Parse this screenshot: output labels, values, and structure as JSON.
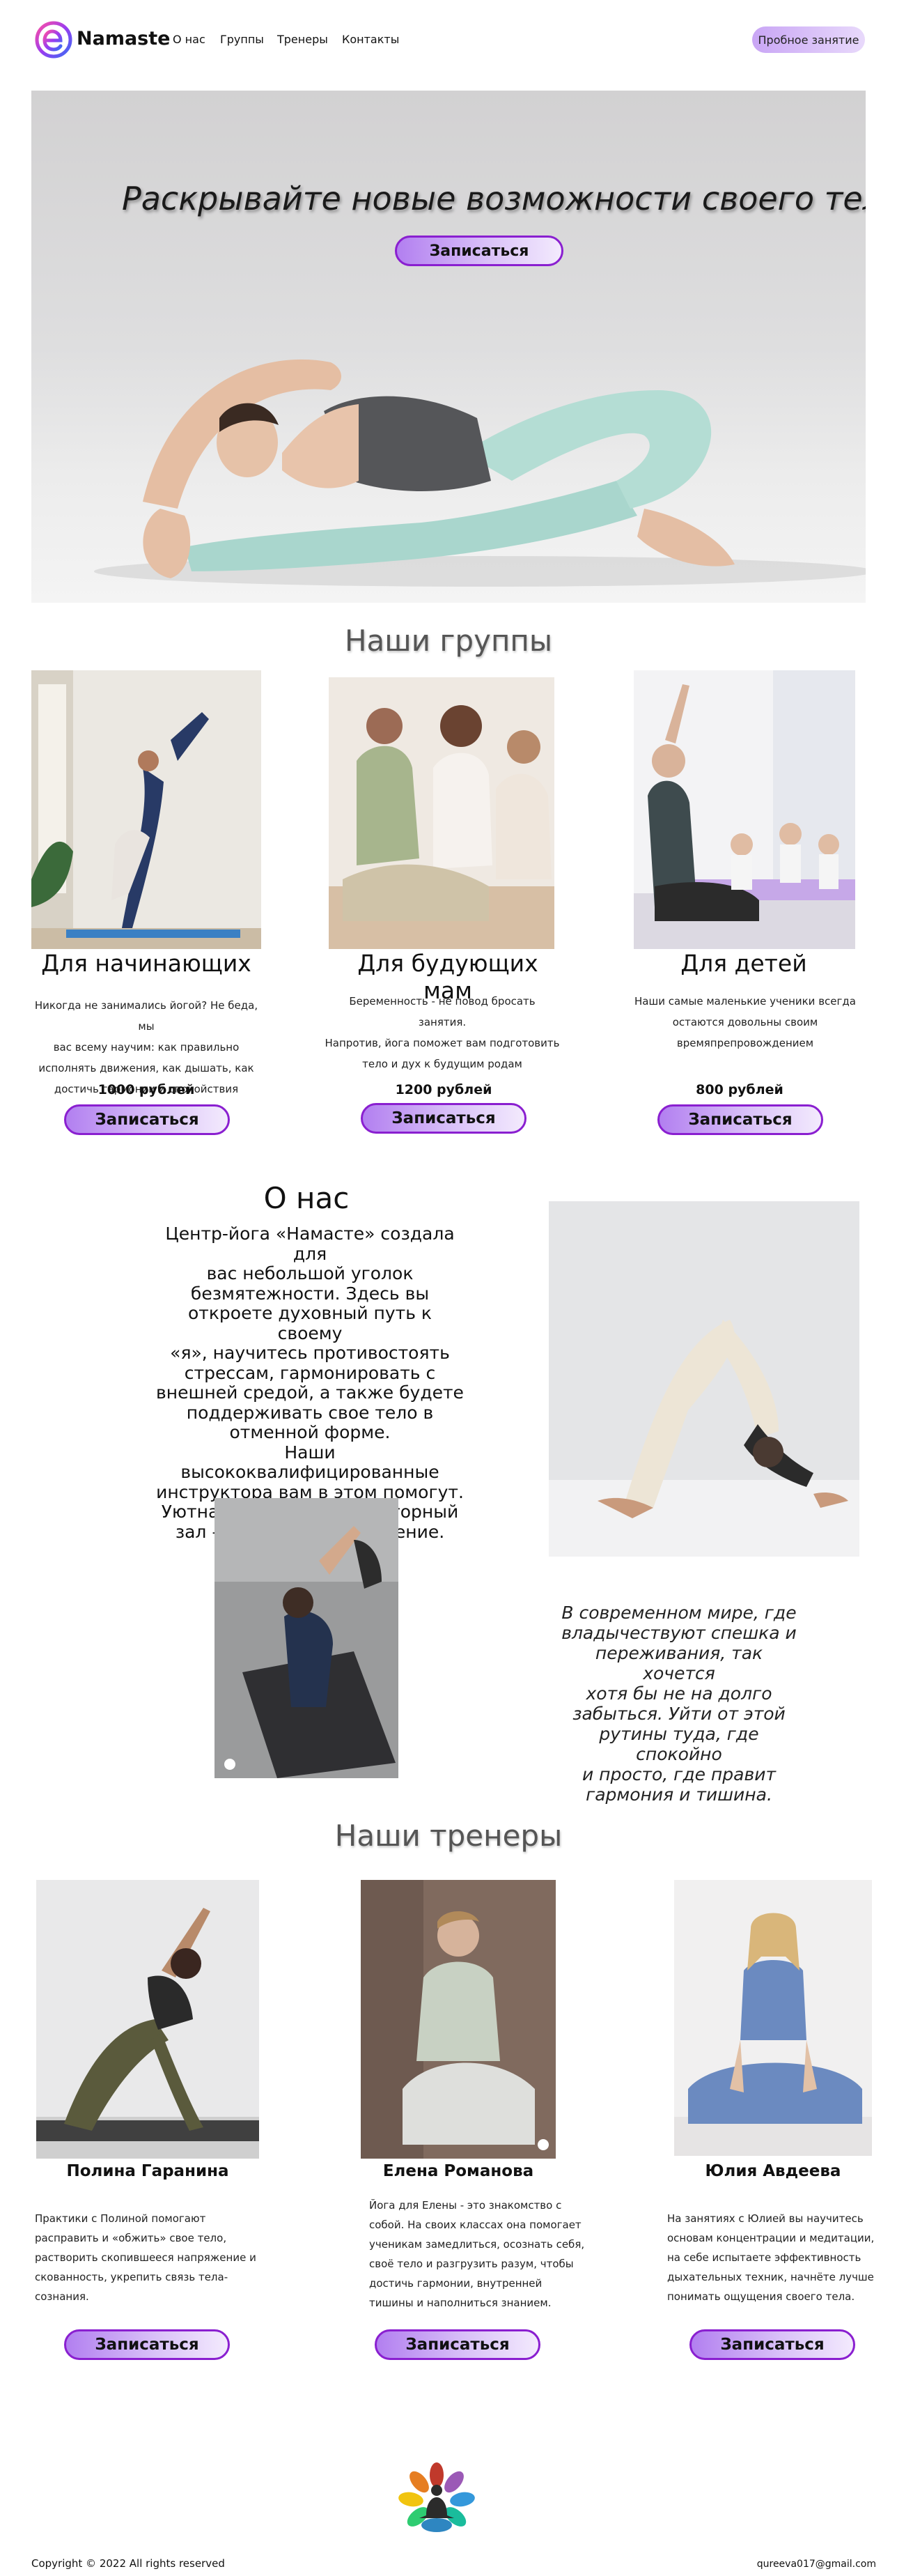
{
  "header": {
    "brand": "Namaste",
    "nav": [
      "О нас",
      "Группы",
      "Тренеры",
      "Контакты"
    ],
    "trial_button": "Пробное занятие"
  },
  "hero": {
    "title": "Раскрывайте новые возможности своего тела",
    "cta": "Записаться"
  },
  "groups": {
    "title": "Наши группы",
    "items": [
      {
        "title": "Для начинающих",
        "desc": [
          "Никогда не занимались йогой? Не беда, мы",
          "вас  всему научим: как правильно",
          "исполнять движения, как дышать, как",
          "достичь гармонии и спокойствия"
        ],
        "price": "1000 рублей",
        "cta": "Записаться"
      },
      {
        "title": "Для будующих мам",
        "desc": [
          "Беременность - не повод бросать занятия.",
          "Напротив, йога поможет вам подготовить",
          "тело и дух к будущим родам"
        ],
        "price": "1200 рублей",
        "cta": "Записаться"
      },
      {
        "title": "Для детей",
        "desc": [
          "Наши самые маленькие ученики всегда",
          "остаются довольны своим",
          "времяпрепровождением"
        ],
        "price": "800 рублей",
        "cta": "Записаться"
      }
    ]
  },
  "about": {
    "title": "О нас",
    "text": [
      "Центр-йога «Намасте» создала для",
      "вас небольшой уголок",
      "безмятежности. Здесь вы",
      "откроете духовный путь к своему",
      "«я», научитесь противостоять",
      "стрессам, гармонировать с",
      "внешней средой, а также будете",
      "поддерживать свое тело в",
      "отменной форме.",
      "Наши высококвалифицированные",
      "инструктора вам в этом помогут.",
      "Уютная атмосфера, просторный",
      "зал — приятное дополнение."
    ],
    "quote": [
      "В современном мире, где",
      "владычествуют спешка и",
      "переживания, так хочется",
      "хотя бы не на долго",
      "забыться. Уйти от этой",
      "рутины туда, где спокойно",
      "и просто, где правит",
      "гармония и тишина."
    ]
  },
  "trainers": {
    "title": "Наши тренеры",
    "items": [
      {
        "name": "Полина Гаранина",
        "desc": [
          "Практики с Полиной помогают",
          "расправить и «обжить» свое тело,",
          "растворить скопившееся напряжение и",
          "скованность, укрепить связь тела-",
          "сознания."
        ],
        "cta": "Записаться"
      },
      {
        "name": "Елена Романова",
        "desc": [
          "Йога для Елены - это знакомство с",
          "собой. На своих классах она помогает",
          "ученикам замедлиться, осознать себя,",
          "своё тело и разгрузить разум, чтобы",
          "достичь гармонии, внутренней",
          "тишины и наполниться знанием."
        ],
        "cta": "Записаться"
      },
      {
        "name": "Юлия Авдеева",
        "desc": [
          "На занятиях  с Юлией вы научитесь",
          "основам концентрации и медитации,",
          "на себе испытаете эффективность",
          "дыхательных техник, начнёте лучше",
          "понимать ощущения своего тела."
        ],
        "cta": "Записаться"
      }
    ]
  },
  "footer": {
    "copyright": "Copyright © 2022 All rights reserved",
    "email": "qureeva017@gmail.com"
  },
  "colors": {
    "accent": "#8a1fd0",
    "button_gradient_start": "#b27ff0",
    "button_gradient_end": "#f3eafd"
  }
}
